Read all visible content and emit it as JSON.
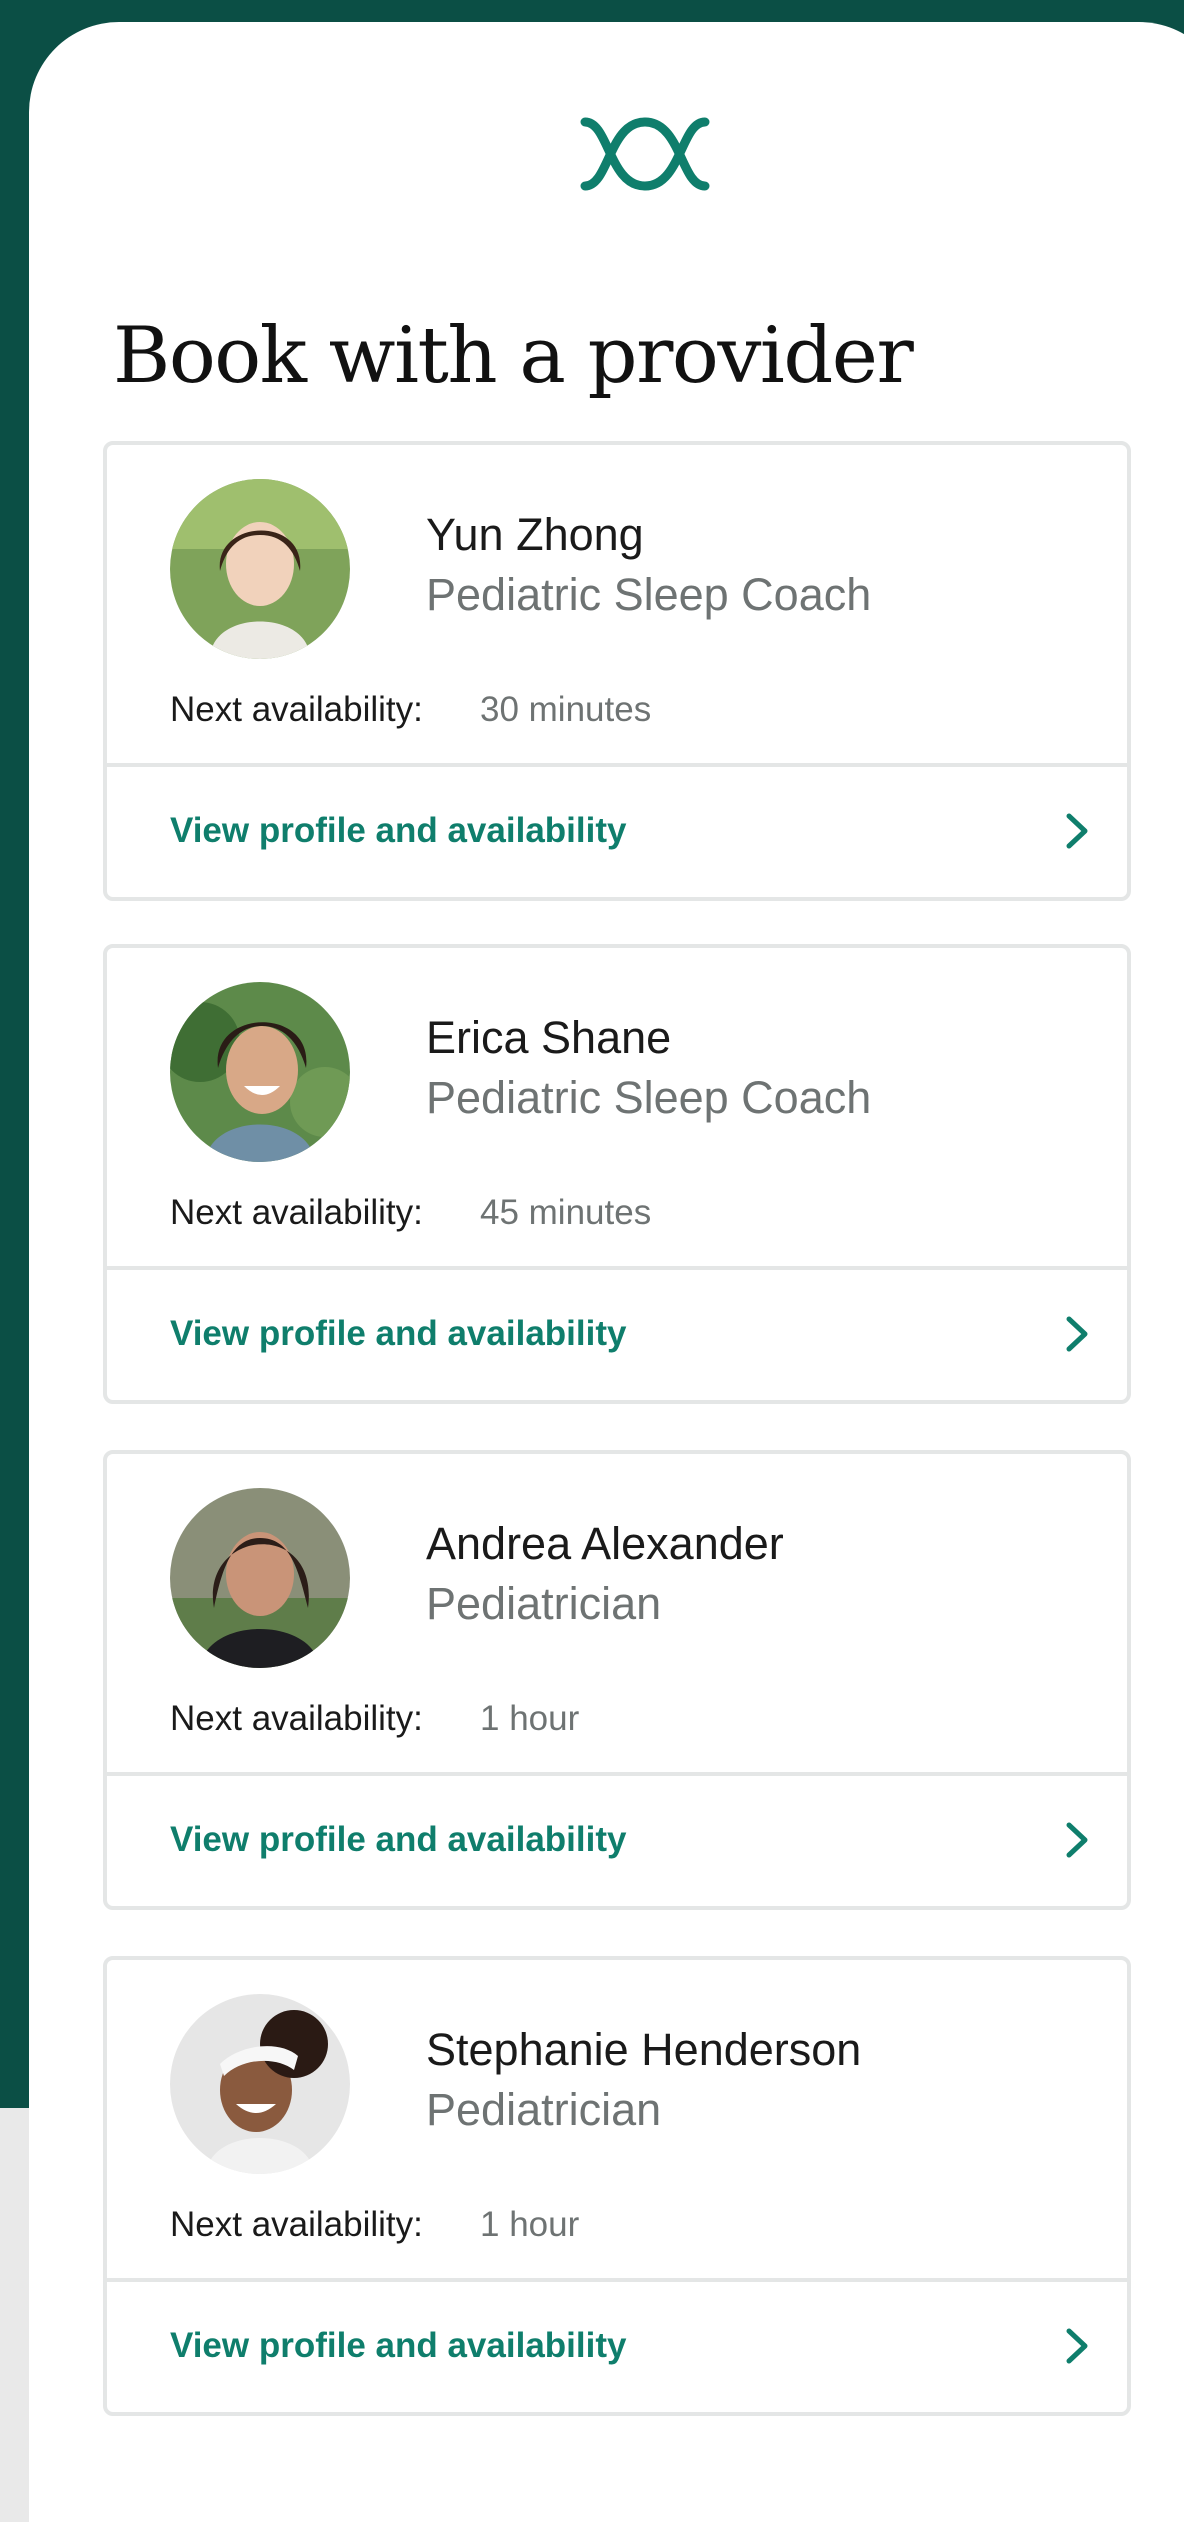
{
  "page": {
    "title": "Book with a provider",
    "colors": {
      "brand_dark_green": "#0b4f45",
      "accent_teal": "#0f7e6c",
      "text_primary": "#1a1a1a",
      "text_secondary": "#6e7373",
      "border": "#e4e6e6"
    }
  },
  "logo": {
    "icon": "brand-wave-logo-icon"
  },
  "providers": [
    {
      "name": "Yun Zhong",
      "role": "Pediatric Sleep Coach",
      "availability_label": "Next availability:",
      "availability_value": "30 minutes",
      "link_label": "View profile and availability",
      "link_icon": "chevron-right-icon"
    },
    {
      "name": "Erica Shane",
      "role": "Pediatric Sleep Coach",
      "availability_label": "Next availability:",
      "availability_value": "45 minutes",
      "link_label": "View profile and availability",
      "link_icon": "chevron-right-icon"
    },
    {
      "name": "Andrea Alexander",
      "role": "Pediatrician",
      "availability_label": "Next availability:",
      "availability_value": "1 hour",
      "link_label": "View profile and availability",
      "link_icon": "chevron-right-icon"
    },
    {
      "name": "Stephanie Henderson",
      "role": "Pediatrician",
      "availability_label": "Next availability:",
      "availability_value": "1 hour",
      "link_label": "View profile and availability",
      "link_icon": "chevron-right-icon"
    }
  ]
}
